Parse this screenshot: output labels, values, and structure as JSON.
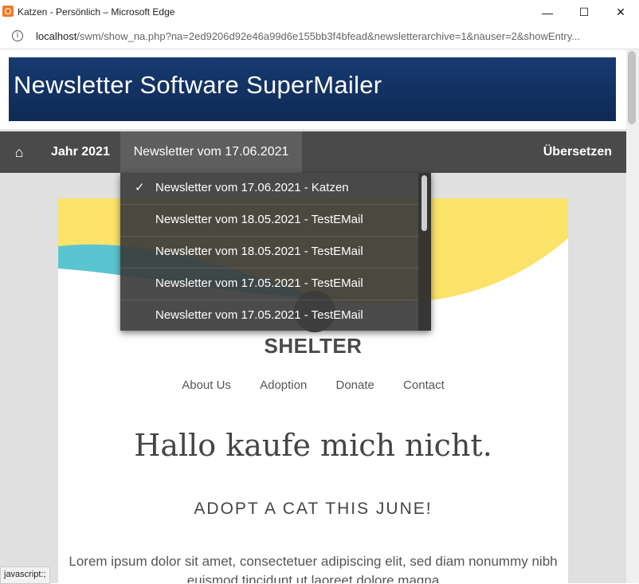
{
  "window": {
    "title": "Katzen - Persönlich – Microsoft Edge",
    "minimize": "—",
    "maximize": "☐",
    "close": "✕"
  },
  "address": {
    "url_host": "localhost",
    "url_rest": "/swm/show_na.php?na=2ed9206d92e46a99d6e155bb3f4bfead&newsletterarchive=1&nauser=2&showEntry..."
  },
  "banner": {
    "title": "Newsletter Software SuperMailer"
  },
  "nav": {
    "home_icon": "⌂",
    "year": "Jahr 2021",
    "newsletter": "Newsletter vom 17.06.2021",
    "translate": "Übersetzen"
  },
  "dropdown": {
    "items": [
      {
        "check": "✓",
        "label": "Newsletter vom 17.06.2021 - Katzen"
      },
      {
        "check": "",
        "label": "Newsletter vom 18.05.2021 - TestEMail"
      },
      {
        "check": "",
        "label": "Newsletter vom 18.05.2021 - TestEMail"
      },
      {
        "check": "",
        "label": "Newsletter vom 17.05.2021 - TestEMail"
      },
      {
        "check": "",
        "label": "Newsletter vom 17.05.2021 - TestEMail"
      }
    ]
  },
  "newsletter": {
    "logo_text": "SHELTER",
    "menu": [
      "About Us",
      "Adoption",
      "Donate",
      "Contact"
    ],
    "headline": "Hallo kaufe mich nicht.",
    "subhead": "ADOPT A CAT THIS JUNE!",
    "body": "Lorem ipsum dolor sit amet, consectetuer adipiscing elit, sed diam nonummy nibh euismod tincidunt ut laoreet dolore magna"
  },
  "colors": {
    "wave_yellow": "#fbe36a",
    "wave_teal": "#5bc4d1",
    "banner_blue": "#173a70"
  },
  "status": {
    "text": "javascript:;"
  }
}
